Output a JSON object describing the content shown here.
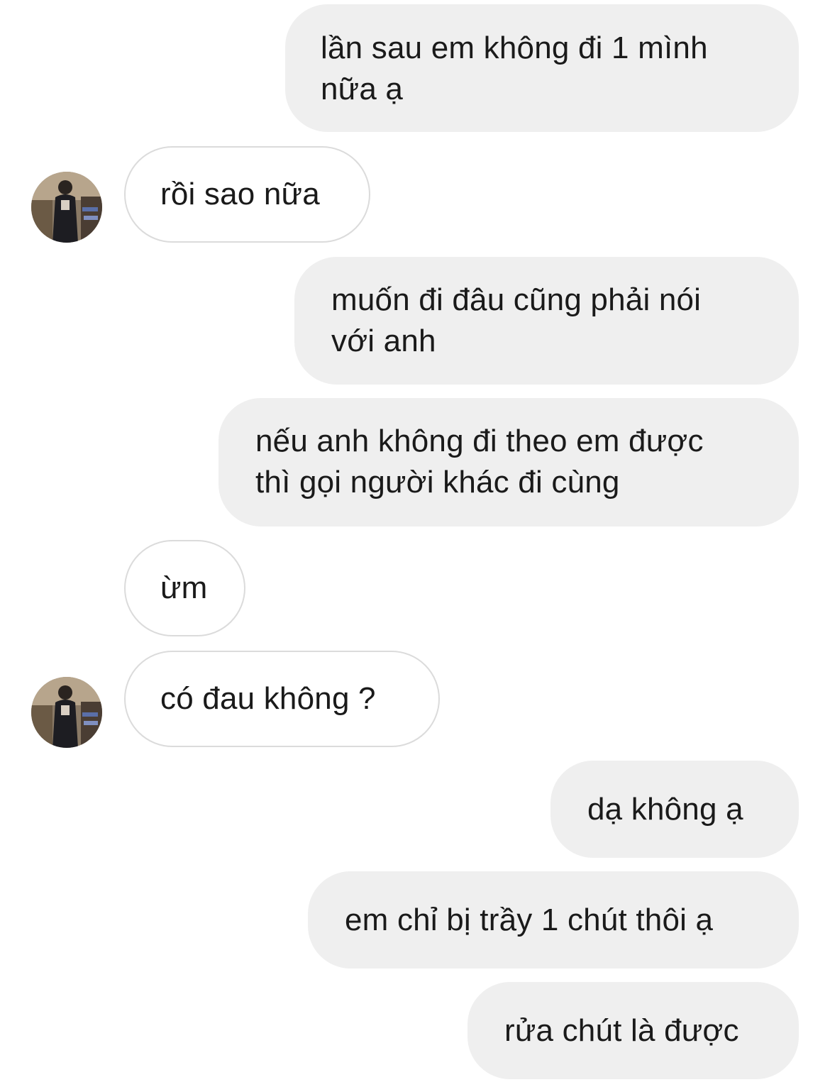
{
  "conversation": {
    "messages": [
      {
        "from": "me",
        "text": "lần sau em không đi 1 mình\nnữa ạ"
      },
      {
        "from": "other",
        "text": "rồi sao nữa"
      },
      {
        "from": "me",
        "text": "muốn đi đâu cũng phải nói\nvới anh"
      },
      {
        "from": "me",
        "text": "nếu anh không đi theo em được\nthì gọi người khác đi cùng"
      },
      {
        "from": "other",
        "text": "ừm"
      },
      {
        "from": "other",
        "text": "có đau không ?"
      },
      {
        "from": "me",
        "text": "dạ không ạ"
      },
      {
        "from": "me",
        "text": "em chỉ bị trầy 1 chút thôi ạ"
      },
      {
        "from": "me",
        "text": "rửa chút là được"
      }
    ]
  },
  "colors": {
    "sent_bubble": "#efefef",
    "received_border": "#dbdbdb",
    "text": "#1a1a1a"
  }
}
